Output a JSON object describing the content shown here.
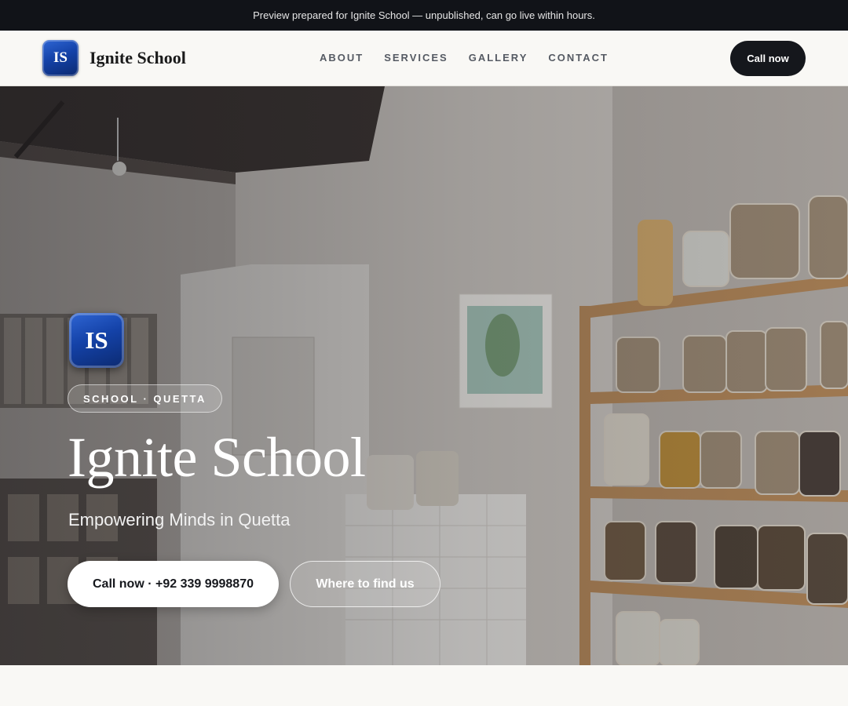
{
  "preview_banner": "Preview prepared for Ignite School — unpublished, can go live within hours.",
  "header": {
    "logo_initials": "IS",
    "brand_name": "Ignite School",
    "nav": [
      "ABOUT",
      "SERVICES",
      "GALLERY",
      "CONTACT"
    ],
    "call_label": "Call now"
  },
  "hero": {
    "logo_initials": "IS",
    "tag": "SCHOOL · QUETTA",
    "title": "Ignite School",
    "subtitle": "Empowering Minds in Quetta",
    "primary_cta": "Call now · +92 339 9998870",
    "secondary_cta": "Where to find us",
    "image_description_icon": "pantry-shelves-photo"
  },
  "colors": {
    "dark": "#111318",
    "brand_blue": "#1442a8",
    "page_bg": "#f9f8f5"
  }
}
